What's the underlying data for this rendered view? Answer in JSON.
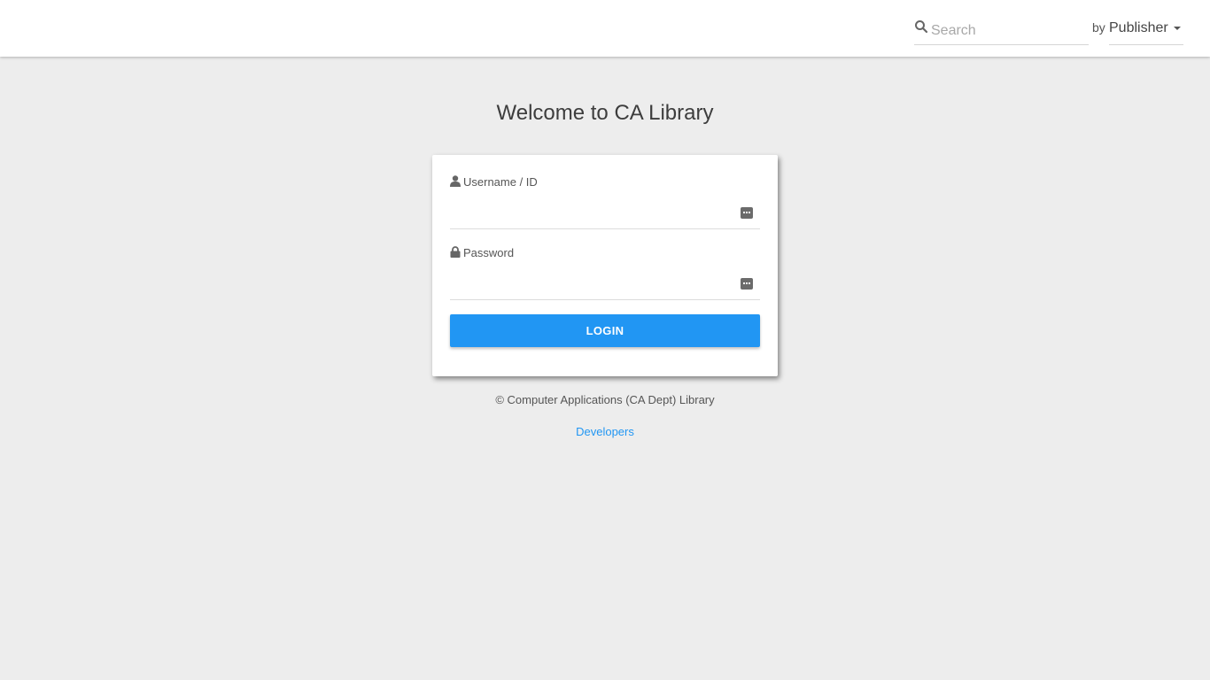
{
  "header": {
    "search": {
      "placeholder": "Search",
      "value": ""
    },
    "filter": {
      "prefix": "by",
      "selected": "Publisher"
    }
  },
  "main": {
    "title": "Welcome to CA Library",
    "login_card": {
      "username_label": "Username / ID",
      "username_value": "",
      "password_label": "Password",
      "password_value": "",
      "login_button_label": "LOGIN"
    },
    "footer_text": "© Computer Applications (CA Dept) Library",
    "developers_link": "Developers"
  },
  "icons": {
    "search": "search-icon",
    "user": "user-icon",
    "lock": "lock-icon",
    "password_manager": "password-manager-icon",
    "dropdown": "caret-down-icon"
  },
  "colors": {
    "accent": "#2196f3",
    "background": "#ededed",
    "card": "#ffffff"
  }
}
